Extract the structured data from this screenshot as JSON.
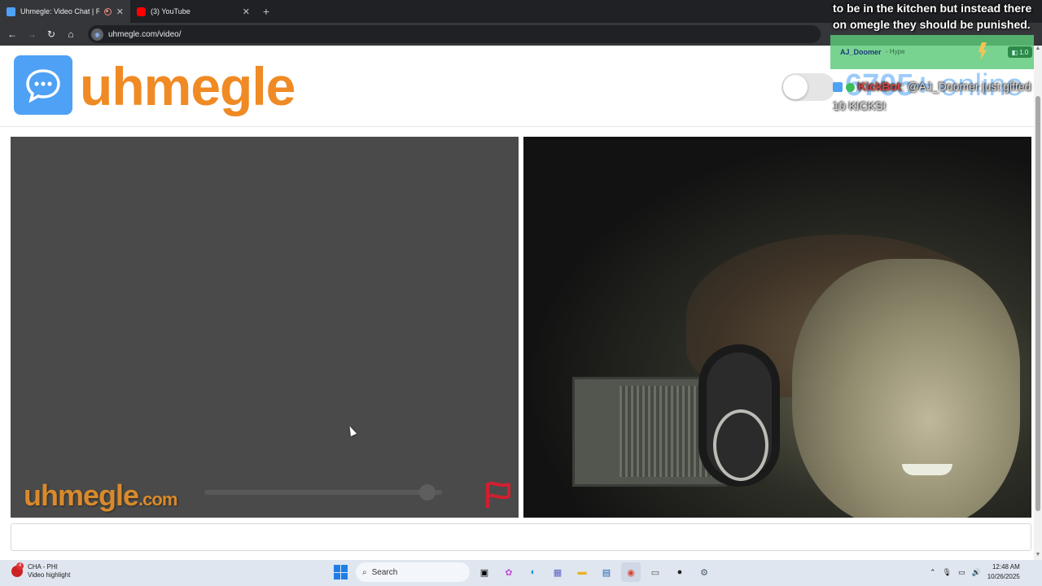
{
  "browser": {
    "tabs": [
      {
        "title": "Uhmegle: Video Chat | Rand",
        "active": true
      },
      {
        "title": "(3) YouTube",
        "active": false
      }
    ],
    "url": "uhmegle.com/video/"
  },
  "header": {
    "logo_text": "uhmegle",
    "online_count": "6705+",
    "online_label": "online"
  },
  "video_left": {
    "watermark": "uhmegle",
    "watermark_domain": ".com",
    "volume_level": 0.97
  },
  "overlay": {
    "message_text": "to be in the kitchen but instead there on omegle they should be punished.",
    "hype_user": "AJ_Doomer",
    "hype_label": "- Hype",
    "hype_badge": "1.0",
    "kick_bot": "KickBot",
    "kick_message": ": @AJ_Doomer just gifted 10 KICKS!"
  },
  "taskbar": {
    "notification_count": "4",
    "app_title": "CHA - PHI",
    "app_subtitle": "Video highlight",
    "search_label": "Search",
    "time": "12:48 AM",
    "date": "10/26/2025"
  },
  "colors": {
    "brand_orange": "#f08a24",
    "brand_blue": "#4ea1f5",
    "flag_red": "#d0202f"
  }
}
